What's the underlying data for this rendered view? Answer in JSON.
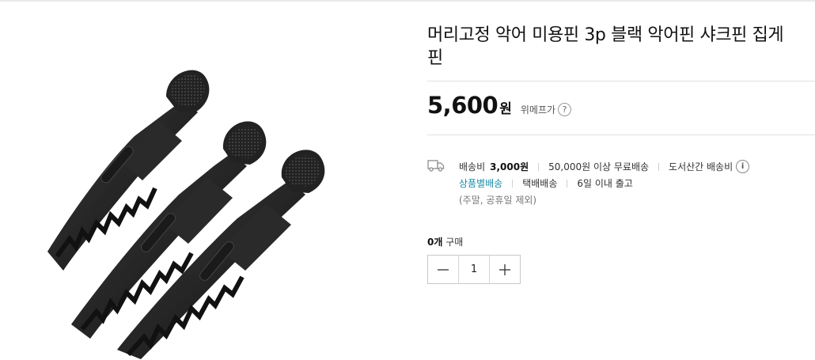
{
  "product": {
    "title": "머리고정 악어 미용핀 3p 블랙 악어핀 샤크핀 집게핀",
    "image_alt": "black-hair-clips"
  },
  "price": {
    "amount": "5,600",
    "unit": "원",
    "label": "위메프가",
    "help_icon": "?"
  },
  "shipping": {
    "icon": "truck-icon",
    "fee_label": "배송비",
    "fee_value": "3,000원",
    "free_condition": "50,000원 이상 무료배송",
    "island_fee": "도서산간 배송비",
    "info_icon": "i",
    "method": "상품별배송",
    "courier": "택배배송",
    "lead_time": "6일 이내 출고",
    "note": "(주말, 공휴일 제외)"
  },
  "purchase": {
    "count": "0개",
    "label": "구매",
    "quantity": "1"
  },
  "colors": {
    "accent_teal": "#1b8ba6"
  }
}
